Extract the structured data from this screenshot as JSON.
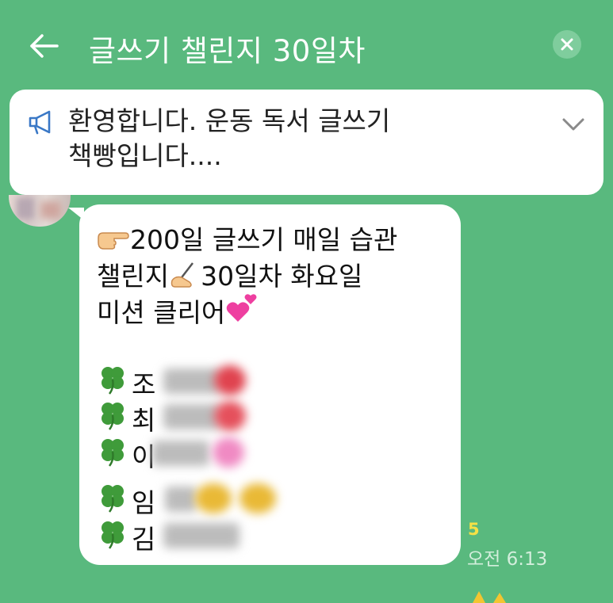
{
  "header": {
    "title": "글쓰기 챌린지 30일차"
  },
  "notice": {
    "line1": "환영합니다. 운동 독서 글쓰기",
    "line2": "책빵입니다...."
  },
  "message": {
    "line1": "200일  글쓰기 매일  습관",
    "line2_a": "챌린지",
    "line2_b": "30일차 화요일",
    "line3": "미션 클리어",
    "members": [
      {
        "initial": "조"
      },
      {
        "initial": "최"
      },
      {
        "initial": "이"
      },
      {
        "initial": "임"
      },
      {
        "initial": "김"
      }
    ],
    "unread_count": "5",
    "time": "오전 6:13"
  },
  "colors": {
    "background": "#59b97e",
    "bubble": "#ffffff",
    "unread": "#f5e146",
    "clover": "#3f9b3a"
  },
  "icons": {
    "back": "arrow-left-icon",
    "close": "close-icon",
    "notice": "megaphone-icon",
    "expand": "chevron-down-icon",
    "member_bullet": "four-leaf-clover-icon"
  }
}
